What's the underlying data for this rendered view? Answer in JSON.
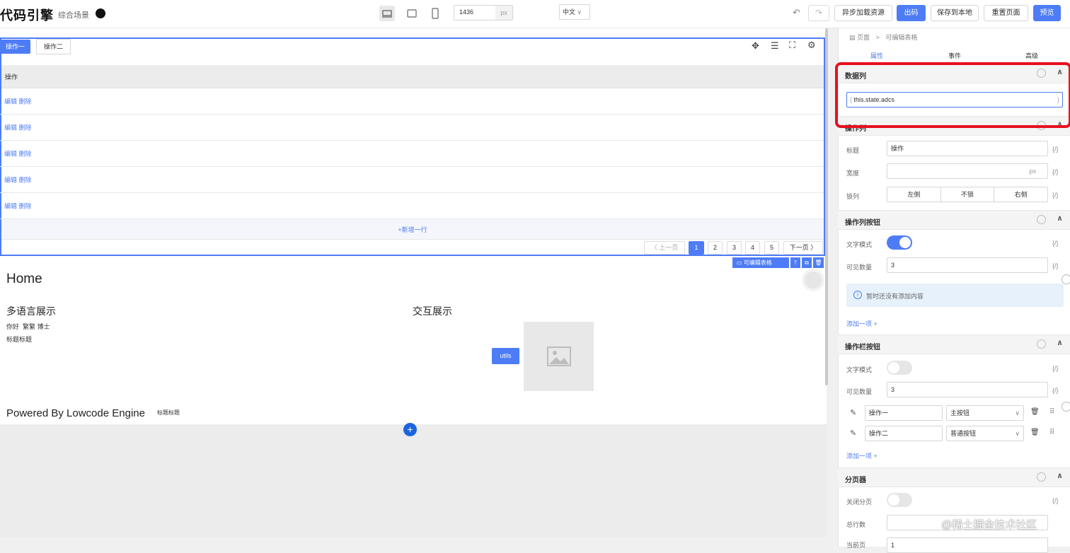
{
  "topbar": {
    "logo": "代码引擎",
    "scene": "综合场景",
    "width_value": "1436",
    "width_unit": "px",
    "lang": "中文",
    "btn_async": "异步加载资源",
    "btn_export": "出码",
    "btn_save": "保存到本地",
    "btn_reset": "重置页面",
    "btn_preview": "预览"
  },
  "table": {
    "action1": "操作一",
    "action2": "操作二",
    "header": "操作",
    "rows": [
      "编辑  删除",
      "编辑  删除",
      "编辑  删除",
      "编辑  删除",
      "编辑  删除"
    ],
    "add_row": "+新增一行",
    "prev": "上一页",
    "next": "下一页",
    "pages": [
      "1",
      "2",
      "3",
      "4",
      "5"
    ],
    "selected_label": "可编辑表格"
  },
  "canvas": {
    "home": "Home",
    "multi_lang": "多语言展示",
    "hello": "你好  繁繁 博士",
    "title_title": "标题标题",
    "interaction": "交互展示",
    "utils_btn": "utils",
    "powered": "Powered By Lowcode Engine",
    "powered_small": "标题标题"
  },
  "panel": {
    "breadcrumb_root": "页面",
    "breadcrumb_sep": ">",
    "breadcrumb_leaf": "可编辑表格",
    "tab_props": "属性",
    "tab_events": "事件",
    "tab_advanced": "高级",
    "sec_data": "数据列",
    "data_value": "this.state.adcs",
    "sec_opcol": "操作列",
    "title_label": "标题",
    "title_value": "操作",
    "width_label": "宽度",
    "width_unit": "px",
    "lock_label": "锁列",
    "lock_opts": [
      "左侧",
      "不锁",
      "右侧"
    ],
    "sec_opbtn": "操作列按钮",
    "text_mode": "文字模式",
    "visible_count": "可见数量",
    "visible_value": "3",
    "empty_notice": "暂时还没有添加内容",
    "add_item": "添加一项 +",
    "sec_barbtn": "操作栏按钮",
    "visible_value2": "3",
    "bar_items": [
      {
        "name": "操作一",
        "type": "主按钮"
      },
      {
        "name": "操作二",
        "type": "普通按钮"
      }
    ],
    "add_item2": "添加一项 +",
    "sec_pager": "分页器",
    "close_pager": "关闭分页",
    "total_rows": "总行数",
    "current_page": "当前页",
    "current_page_value": "1",
    "fx": "{/}",
    "toggle_on": true,
    "toggle_off": false
  },
  "watermark": "@稀土掘金技术社区",
  "colors": {
    "accent": "#4d7cf6",
    "highlight": "#e8101f"
  }
}
